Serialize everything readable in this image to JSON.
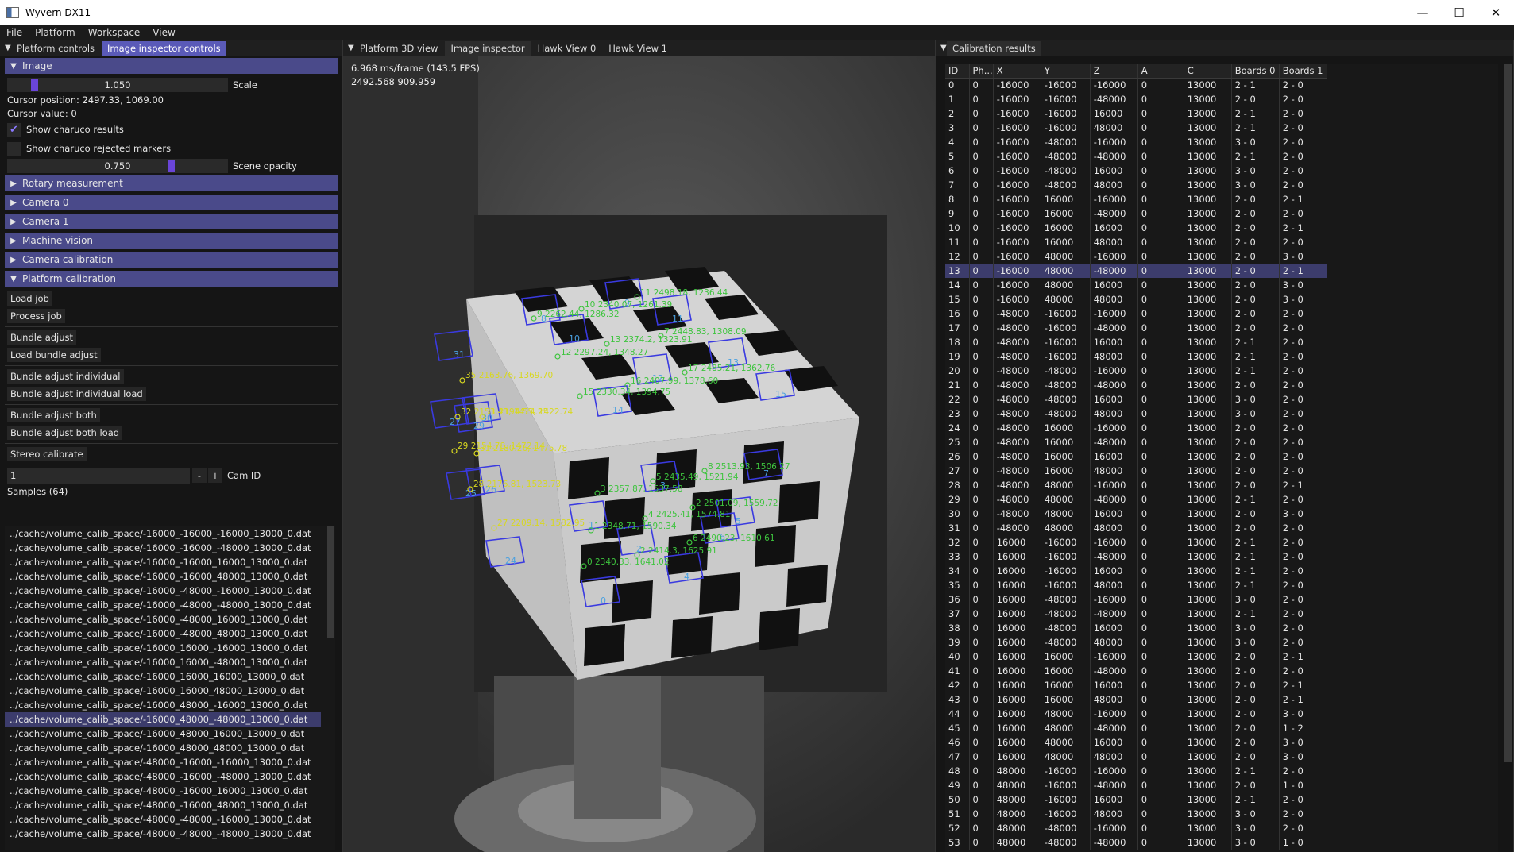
{
  "window": {
    "title": "Wyvern DX11",
    "minimize": "—",
    "maximize": "☐",
    "close": "✕"
  },
  "menu": [
    "File",
    "Platform",
    "Workspace",
    "View"
  ],
  "left": {
    "tabs": [
      "Platform controls",
      "Image inspector controls"
    ],
    "image_header": "Image",
    "scale_value": "1.050",
    "scale_label": "Scale",
    "cursor_position": "Cursor position: 2497.33, 1069.00",
    "cursor_value": "Cursor value: 0",
    "show_charuco_results": "Show charuco results",
    "show_charuco_rejected": "Show charuco rejected markers",
    "opacity_value": "0.750",
    "opacity_label": "Scene opacity",
    "headers": [
      "Rotary measurement",
      "Camera 0",
      "Camera 1",
      "Machine vision",
      "Camera calibration"
    ],
    "platform_calibration": "Platform calibration",
    "buttons": {
      "load_job": "Load job",
      "process_job": "Process job",
      "bundle_adjust": "Bundle adjust",
      "load_bundle_adjust": "Load bundle adjust",
      "bundle_adjust_individual": "Bundle adjust individual",
      "bundle_adjust_individual_load": "Bundle adjust individual load",
      "bundle_adjust_both": "Bundle adjust both",
      "bundle_adjust_both_load": "Bundle adjust both load",
      "stereo_calibrate": "Stereo calibrate"
    },
    "cam_id_value": "1",
    "minus": "-",
    "plus": "+",
    "cam_id_label": "Cam ID",
    "samples_label": "Samples (64)",
    "samples": [
      "../cache/volume_calib_space/-16000_-16000_-16000_13000_0.dat",
      "../cache/volume_calib_space/-16000_-16000_-48000_13000_0.dat",
      "../cache/volume_calib_space/-16000_-16000_16000_13000_0.dat",
      "../cache/volume_calib_space/-16000_-16000_48000_13000_0.dat",
      "../cache/volume_calib_space/-16000_-48000_-16000_13000_0.dat",
      "../cache/volume_calib_space/-16000_-48000_-48000_13000_0.dat",
      "../cache/volume_calib_space/-16000_-48000_16000_13000_0.dat",
      "../cache/volume_calib_space/-16000_-48000_48000_13000_0.dat",
      "../cache/volume_calib_space/-16000_16000_-16000_13000_0.dat",
      "../cache/volume_calib_space/-16000_16000_-48000_13000_0.dat",
      "../cache/volume_calib_space/-16000_16000_16000_13000_0.dat",
      "../cache/volume_calib_space/-16000_16000_48000_13000_0.dat",
      "../cache/volume_calib_space/-16000_48000_-16000_13000_0.dat",
      "../cache/volume_calib_space/-16000_48000_-48000_13000_0.dat",
      "../cache/volume_calib_space/-16000_48000_16000_13000_0.dat",
      "../cache/volume_calib_space/-16000_48000_48000_13000_0.dat",
      "../cache/volume_calib_space/-48000_-16000_-16000_13000_0.dat",
      "../cache/volume_calib_space/-48000_-16000_-48000_13000_0.dat",
      "../cache/volume_calib_space/-48000_-16000_16000_13000_0.dat",
      "../cache/volume_calib_space/-48000_-16000_48000_13000_0.dat",
      "../cache/volume_calib_space/-48000_-48000_-16000_13000_0.dat",
      "../cache/volume_calib_space/-48000_-48000_-48000_13000_0.dat"
    ],
    "selected_sample": 13
  },
  "middle": {
    "tabs": [
      "Platform 3D view",
      "Image inspector",
      "Hawk View 0",
      "Hawk View 1"
    ],
    "fps": "6.968 ms/frame (143.5 FPS)",
    "coords": "2492.568 909.959",
    "green_labels": [
      "11 2498.18, 1236.44",
      "9 2262.44, 1286.32",
      "10 2340.07, 1261.39",
      "7 2448.83, 1308.09",
      "13 2374.2, 1323.91",
      "12 2297.24, 1348.27",
      "17 2485.21, 1362.76",
      "16 2407.99, 1378.60",
      "15 2330.34, 1394.75",
      "8 2513.93, 1506.27",
      "5 2435.49, 1521.94",
      "3 2357.87, 1537.58",
      "2 2501.09, 1559.72",
      "4 2425.41, 1574.81",
      "1 2348.71, 1590.34",
      "6 2490.23, 1610.61",
      "0 2340.33, 1641.02",
      "2 2414.3, 1625.91"
    ],
    "yellow_labels": [
      "35 2163.76, 1369.70",
      "32 2153.43, 1414.25",
      "31 2194.55, 1422.74",
      "29 2154.78, 1472.14",
      "31 2180.26, 1475.78",
      "28 2176.81, 1523.73",
      "27 2209.14, 1582.95"
    ],
    "marker_ids": [
      "8",
      "9",
      "10",
      "11",
      "12",
      "13",
      "14",
      "15",
      "31",
      "30",
      "29",
      "27",
      "26",
      "25",
      "24",
      "7",
      "3",
      "5",
      "6",
      "2",
      "1",
      "4",
      "0"
    ]
  },
  "right": {
    "tab": "Calibration results",
    "columns": [
      "ID",
      "Ph...",
      "X",
      "Y",
      "Z",
      "A",
      "C",
      "Boards 0",
      "Boards 1"
    ],
    "rows": [
      [
        "0",
        "0",
        "-16000",
        "-16000",
        "-16000",
        "0",
        "13000",
        "2 - 1",
        "2 - 0"
      ],
      [
        "1",
        "0",
        "-16000",
        "-16000",
        "-48000",
        "0",
        "13000",
        "2 - 0",
        "2 - 0"
      ],
      [
        "2",
        "0",
        "-16000",
        "-16000",
        "16000",
        "0",
        "13000",
        "2 - 1",
        "2 - 0"
      ],
      [
        "3",
        "0",
        "-16000",
        "-16000",
        "48000",
        "0",
        "13000",
        "2 - 1",
        "2 - 0"
      ],
      [
        "4",
        "0",
        "-16000",
        "-48000",
        "-16000",
        "0",
        "13000",
        "3 - 0",
        "2 - 0"
      ],
      [
        "5",
        "0",
        "-16000",
        "-48000",
        "-48000",
        "0",
        "13000",
        "2 - 1",
        "2 - 0"
      ],
      [
        "6",
        "0",
        "-16000",
        "-48000",
        "16000",
        "0",
        "13000",
        "3 - 0",
        "2 - 0"
      ],
      [
        "7",
        "0",
        "-16000",
        "-48000",
        "48000",
        "0",
        "13000",
        "3 - 0",
        "2 - 0"
      ],
      [
        "8",
        "0",
        "-16000",
        "16000",
        "-16000",
        "0",
        "13000",
        "2 - 0",
        "2 - 1"
      ],
      [
        "9",
        "0",
        "-16000",
        "16000",
        "-48000",
        "0",
        "13000",
        "2 - 0",
        "2 - 0"
      ],
      [
        "10",
        "0",
        "-16000",
        "16000",
        "16000",
        "0",
        "13000",
        "2 - 0",
        "2 - 1"
      ],
      [
        "11",
        "0",
        "-16000",
        "16000",
        "48000",
        "0",
        "13000",
        "2 - 0",
        "2 - 0"
      ],
      [
        "12",
        "0",
        "-16000",
        "48000",
        "-16000",
        "0",
        "13000",
        "2 - 0",
        "3 - 0"
      ],
      [
        "13",
        "0",
        "-16000",
        "48000",
        "-48000",
        "0",
        "13000",
        "2 - 0",
        "2 - 1"
      ],
      [
        "14",
        "0",
        "-16000",
        "48000",
        "16000",
        "0",
        "13000",
        "2 - 0",
        "3 - 0"
      ],
      [
        "15",
        "0",
        "-16000",
        "48000",
        "48000",
        "0",
        "13000",
        "2 - 0",
        "3 - 0"
      ],
      [
        "16",
        "0",
        "-48000",
        "-16000",
        "-16000",
        "0",
        "13000",
        "2 - 0",
        "2 - 0"
      ],
      [
        "17",
        "0",
        "-48000",
        "-16000",
        "-48000",
        "0",
        "13000",
        "2 - 0",
        "2 - 0"
      ],
      [
        "18",
        "0",
        "-48000",
        "-16000",
        "16000",
        "0",
        "13000",
        "2 - 1",
        "2 - 0"
      ],
      [
        "19",
        "0",
        "-48000",
        "-16000",
        "48000",
        "0",
        "13000",
        "2 - 1",
        "2 - 0"
      ],
      [
        "20",
        "0",
        "-48000",
        "-48000",
        "-16000",
        "0",
        "13000",
        "2 - 1",
        "2 - 0"
      ],
      [
        "21",
        "0",
        "-48000",
        "-48000",
        "-48000",
        "0",
        "13000",
        "2 - 0",
        "2 - 0"
      ],
      [
        "22",
        "0",
        "-48000",
        "-48000",
        "16000",
        "0",
        "13000",
        "3 - 0",
        "2 - 0"
      ],
      [
        "23",
        "0",
        "-48000",
        "-48000",
        "48000",
        "0",
        "13000",
        "3 - 0",
        "2 - 0"
      ],
      [
        "24",
        "0",
        "-48000",
        "16000",
        "-16000",
        "0",
        "13000",
        "2 - 0",
        "2 - 0"
      ],
      [
        "25",
        "0",
        "-48000",
        "16000",
        "-48000",
        "0",
        "13000",
        "2 - 0",
        "2 - 0"
      ],
      [
        "26",
        "0",
        "-48000",
        "16000",
        "16000",
        "0",
        "13000",
        "2 - 0",
        "2 - 0"
      ],
      [
        "27",
        "0",
        "-48000",
        "16000",
        "48000",
        "0",
        "13000",
        "2 - 0",
        "2 - 0"
      ],
      [
        "28",
        "0",
        "-48000",
        "48000",
        "-16000",
        "0",
        "13000",
        "2 - 0",
        "2 - 1"
      ],
      [
        "29",
        "0",
        "-48000",
        "48000",
        "-48000",
        "0",
        "13000",
        "2 - 1",
        "2 - 0"
      ],
      [
        "30",
        "0",
        "-48000",
        "48000",
        "16000",
        "0",
        "13000",
        "2 - 0",
        "3 - 0"
      ],
      [
        "31",
        "0",
        "-48000",
        "48000",
        "48000",
        "0",
        "13000",
        "2 - 0",
        "2 - 0"
      ],
      [
        "32",
        "0",
        "16000",
        "-16000",
        "-16000",
        "0",
        "13000",
        "2 - 1",
        "2 - 0"
      ],
      [
        "33",
        "0",
        "16000",
        "-16000",
        "-48000",
        "0",
        "13000",
        "2 - 1",
        "2 - 0"
      ],
      [
        "34",
        "0",
        "16000",
        "-16000",
        "16000",
        "0",
        "13000",
        "2 - 1",
        "2 - 0"
      ],
      [
        "35",
        "0",
        "16000",
        "-16000",
        "48000",
        "0",
        "13000",
        "2 - 1",
        "2 - 0"
      ],
      [
        "36",
        "0",
        "16000",
        "-48000",
        "-16000",
        "0",
        "13000",
        "3 - 0",
        "2 - 0"
      ],
      [
        "37",
        "0",
        "16000",
        "-48000",
        "-48000",
        "0",
        "13000",
        "2 - 1",
        "2 - 0"
      ],
      [
        "38",
        "0",
        "16000",
        "-48000",
        "16000",
        "0",
        "13000",
        "3 - 0",
        "2 - 0"
      ],
      [
        "39",
        "0",
        "16000",
        "-48000",
        "48000",
        "0",
        "13000",
        "3 - 0",
        "2 - 0"
      ],
      [
        "40",
        "0",
        "16000",
        "16000",
        "-16000",
        "0",
        "13000",
        "2 - 0",
        "2 - 1"
      ],
      [
        "41",
        "0",
        "16000",
        "16000",
        "-48000",
        "0",
        "13000",
        "2 - 0",
        "2 - 0"
      ],
      [
        "42",
        "0",
        "16000",
        "16000",
        "16000",
        "0",
        "13000",
        "2 - 0",
        "2 - 1"
      ],
      [
        "43",
        "0",
        "16000",
        "16000",
        "48000",
        "0",
        "13000",
        "2 - 0",
        "2 - 1"
      ],
      [
        "44",
        "0",
        "16000",
        "48000",
        "-16000",
        "0",
        "13000",
        "2 - 0",
        "3 - 0"
      ],
      [
        "45",
        "0",
        "16000",
        "48000",
        "-48000",
        "0",
        "13000",
        "2 - 0",
        "1 - 2"
      ],
      [
        "46",
        "0",
        "16000",
        "48000",
        "16000",
        "0",
        "13000",
        "2 - 0",
        "3 - 0"
      ],
      [
        "47",
        "0",
        "16000",
        "48000",
        "48000",
        "0",
        "13000",
        "2 - 0",
        "3 - 0"
      ],
      [
        "48",
        "0",
        "48000",
        "-16000",
        "-16000",
        "0",
        "13000",
        "2 - 1",
        "2 - 0"
      ],
      [
        "49",
        "0",
        "48000",
        "-16000",
        "-48000",
        "0",
        "13000",
        "2 - 0",
        "1 - 0"
      ],
      [
        "50",
        "0",
        "48000",
        "-16000",
        "16000",
        "0",
        "13000",
        "2 - 1",
        "2 - 0"
      ],
      [
        "51",
        "0",
        "48000",
        "-16000",
        "48000",
        "0",
        "13000",
        "3 - 0",
        "2 - 0"
      ],
      [
        "52",
        "0",
        "48000",
        "-48000",
        "-16000",
        "0",
        "13000",
        "3 - 0",
        "2 - 0"
      ],
      [
        "53",
        "0",
        "48000",
        "-48000",
        "-48000",
        "0",
        "13000",
        "3 - 0",
        "1 - 0"
      ]
    ],
    "selected_row": 13
  },
  "icons": {
    "menu": "triangle-down-icon",
    "expand": "triangle-right-icon",
    "collapse": "triangle-down-icon",
    "check": "check-icon"
  },
  "colors": {
    "accent": "#5a5ab8",
    "header": "#4a4a8a",
    "green_label": "#3ec43e",
    "yellow_label": "#d8d820",
    "marker_outline": "#3a3ae0"
  }
}
